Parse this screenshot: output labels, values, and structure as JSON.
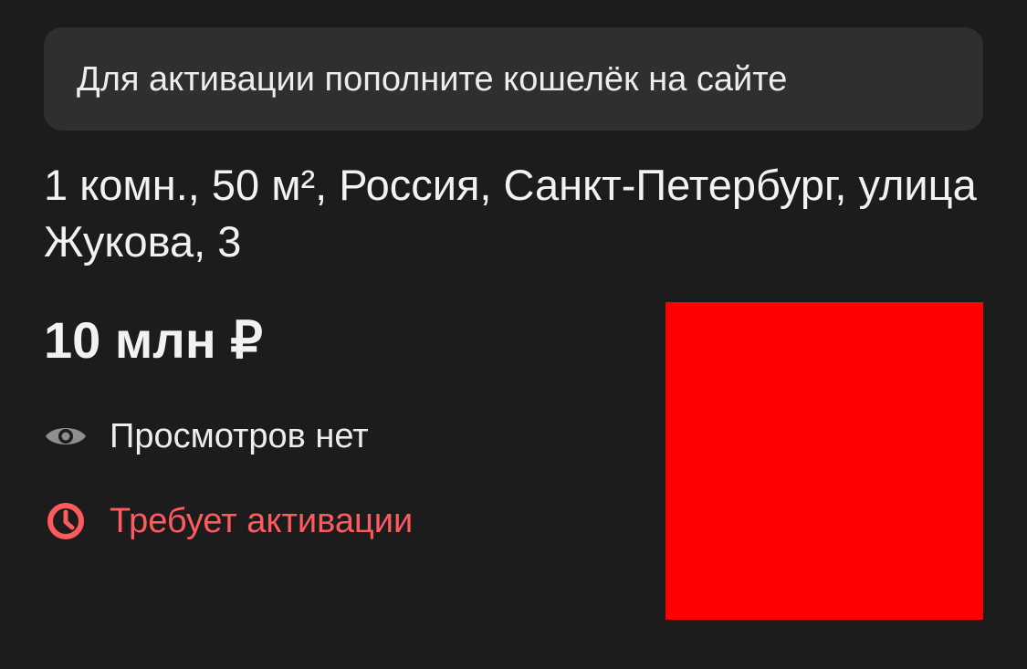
{
  "notice": {
    "text": "Для активации пополните кошелёк на сайте"
  },
  "listing": {
    "title": "1 комн., 50 м², Россия, Санкт-Петербург, улица Жукова, 3",
    "price": "10 млн ₽",
    "views": {
      "icon": "eye-icon",
      "text": "Просмотров нет"
    },
    "status": {
      "icon": "clock-icon",
      "text": "Требует активации",
      "color": "#ff5a5f"
    },
    "photo": {
      "placeholder_color": "#ff0000"
    }
  }
}
